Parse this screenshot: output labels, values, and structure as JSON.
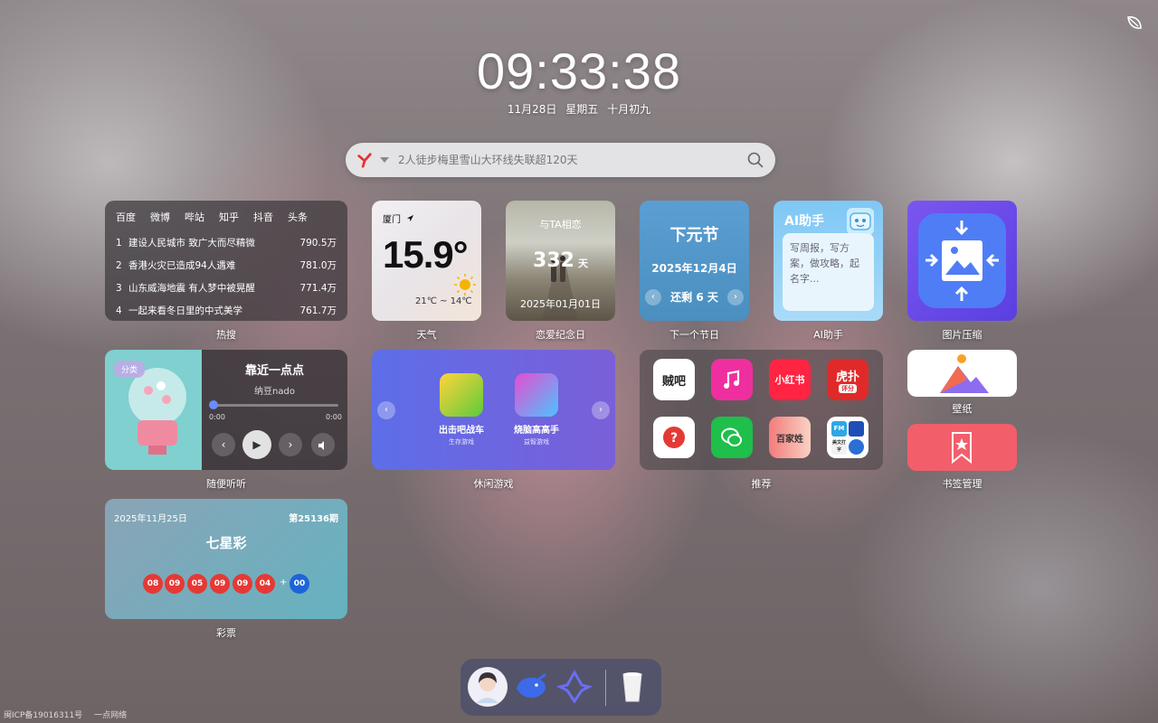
{
  "clock": {
    "time": "09:33:38",
    "date": "11月28日",
    "weekday": "星期五",
    "lunar": "十月初九"
  },
  "search": {
    "placeholder": "2人徒步梅里雪山大环线失联超120天",
    "engine_icon": "engine-logo-icon",
    "search_icon": "search-icon"
  },
  "hot": {
    "tabs": [
      "百度",
      "微博",
      "哔站",
      "知乎",
      "抖音",
      "头条"
    ],
    "items": [
      {
        "rank": "1",
        "title": "建设人民城市 致广大而尽精微",
        "value": "790.5万"
      },
      {
        "rank": "2",
        "title": "香港火灾已造成94人遇难",
        "value": "781.0万"
      },
      {
        "rank": "3",
        "title": "山东威海地震 有人梦中被晃醒",
        "value": "771.4万"
      },
      {
        "rank": "4",
        "title": "一起来看冬日里的中式美学",
        "value": "761.7万"
      }
    ],
    "label": "热搜"
  },
  "weather": {
    "city": "厦门",
    "temp": "15.9°",
    "range": "21℃ ~ 14℃",
    "label": "天气"
  },
  "love": {
    "title": "与TA相恋",
    "days": "332",
    "unit": "天",
    "date": "2025年01月01日",
    "label": "恋爱纪念日"
  },
  "holiday": {
    "name": "下元节",
    "date": "2025年12月4日",
    "remain_prefix": "还剩",
    "remain_days": "6",
    "remain_unit": "天",
    "label": "下一个节日"
  },
  "ai": {
    "title": "AI助手",
    "text": "写周报，写方案，做攻略，起名字...",
    "label": "AI助手"
  },
  "compress": {
    "label": "图片压缩"
  },
  "music": {
    "category": "分类",
    "song": "靠近一点点",
    "artist": "纳豆nado",
    "current": "0:00",
    "total": "0:00",
    "progress": 0,
    "label": "随便听听"
  },
  "games": {
    "items": [
      {
        "name": "出击吧战车",
        "type": "生存游戏"
      },
      {
        "name": "烧脑高高手",
        "type": "益智游戏"
      }
    ],
    "label": "休闲游戏"
  },
  "recommend": {
    "apps": [
      "贼吧",
      "音乐",
      "小红书",
      "虎扑",
      "问答",
      "微信",
      "百家姓",
      "工具集"
    ],
    "texts": {
      "zeiba": "贼吧",
      "xhs": "小红书",
      "hupu": "虎扑",
      "hupu_sub": "评分",
      "bjx": "百家姓",
      "fm": "FM",
      "wenzi": "美文打字"
    },
    "label": "推荐"
  },
  "wallpaper": {
    "label": "壁纸"
  },
  "bookmark": {
    "label": "书签管理"
  },
  "lottery": {
    "date": "2025年11月25日",
    "issue": "第25136期",
    "name": "七星彩",
    "red": [
      "08",
      "09",
      "05",
      "09",
      "09",
      "04"
    ],
    "plus": "+",
    "blue": "00",
    "label": "彩票"
  },
  "footer": {
    "icp": "闽ICP备19016311号",
    "brand": "一点网络"
  },
  "colors": {
    "accent": "#5a3fe0",
    "holiday": "#4a8fbf",
    "lotto_red": "#e53935",
    "lotto_blue": "#1e64d8"
  }
}
